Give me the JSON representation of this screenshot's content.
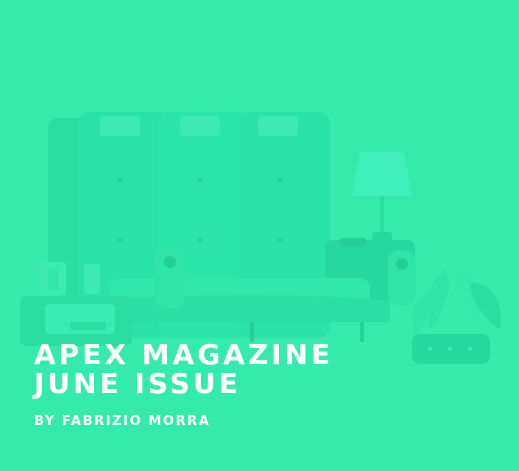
{
  "card": {
    "title_line_1": "APEX MAGAZINE",
    "title_line_2": "JUNE ISSUE",
    "byline": "BY FABRIZIO MORRA"
  },
  "colors": {
    "background": "#34ebac",
    "overlay": "#37edad",
    "text": "#ffffff"
  },
  "illustration": {
    "icons": [
      "sofa-icon",
      "floor-lamp-icon",
      "potted-plant-icon",
      "side-table-icon",
      "lantern-icon"
    ]
  }
}
